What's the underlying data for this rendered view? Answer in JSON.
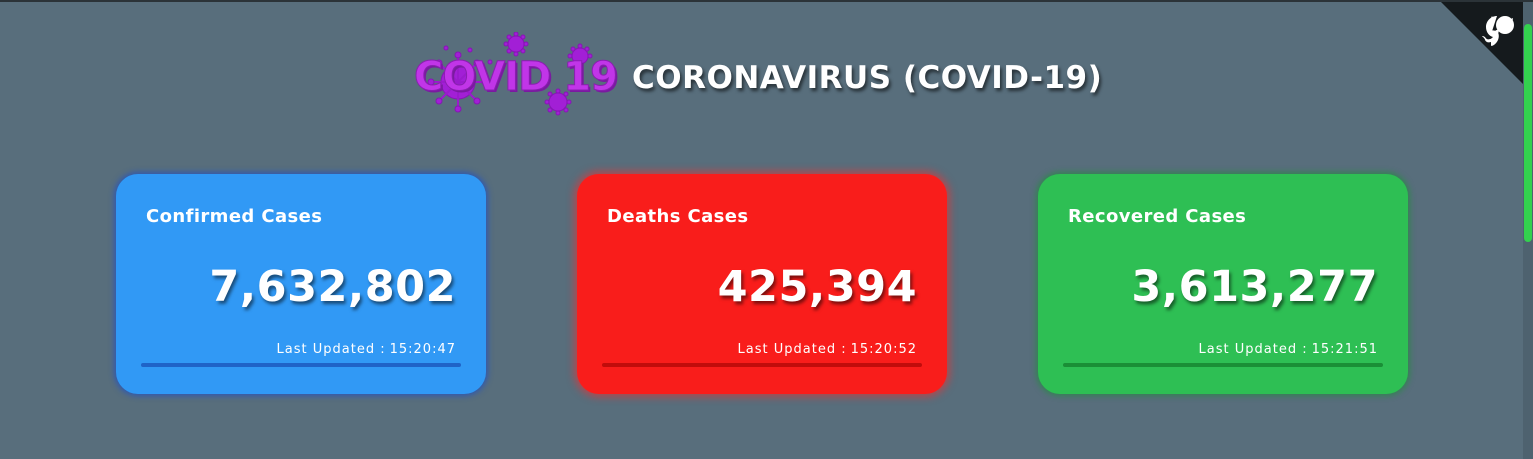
{
  "header": {
    "logo_text": "COVID 19",
    "title": "CORONAVIRUS (COVID-19)"
  },
  "cards": [
    {
      "label": "Confirmed Cases",
      "value": "7,632,802",
      "updated_prefix": "Last Updated :",
      "updated_time": "15:20:47",
      "color": "#3199f5"
    },
    {
      "label": "Deaths Cases",
      "value": "425,394",
      "updated_prefix": "Last Updated :",
      "updated_time": "15:20:52",
      "color": "#f91d1b"
    },
    {
      "label": "Recovered Cases",
      "value": "3,613,277",
      "updated_prefix": "Last Updated :",
      "updated_time": "15:21:51",
      "color": "#2ebf54"
    }
  ],
  "icons": {
    "corner": "github-octocat-icon",
    "logo": "virus-icon"
  },
  "colors": {
    "background": "#586e7c",
    "scroll_thumb": "#33d14e"
  }
}
